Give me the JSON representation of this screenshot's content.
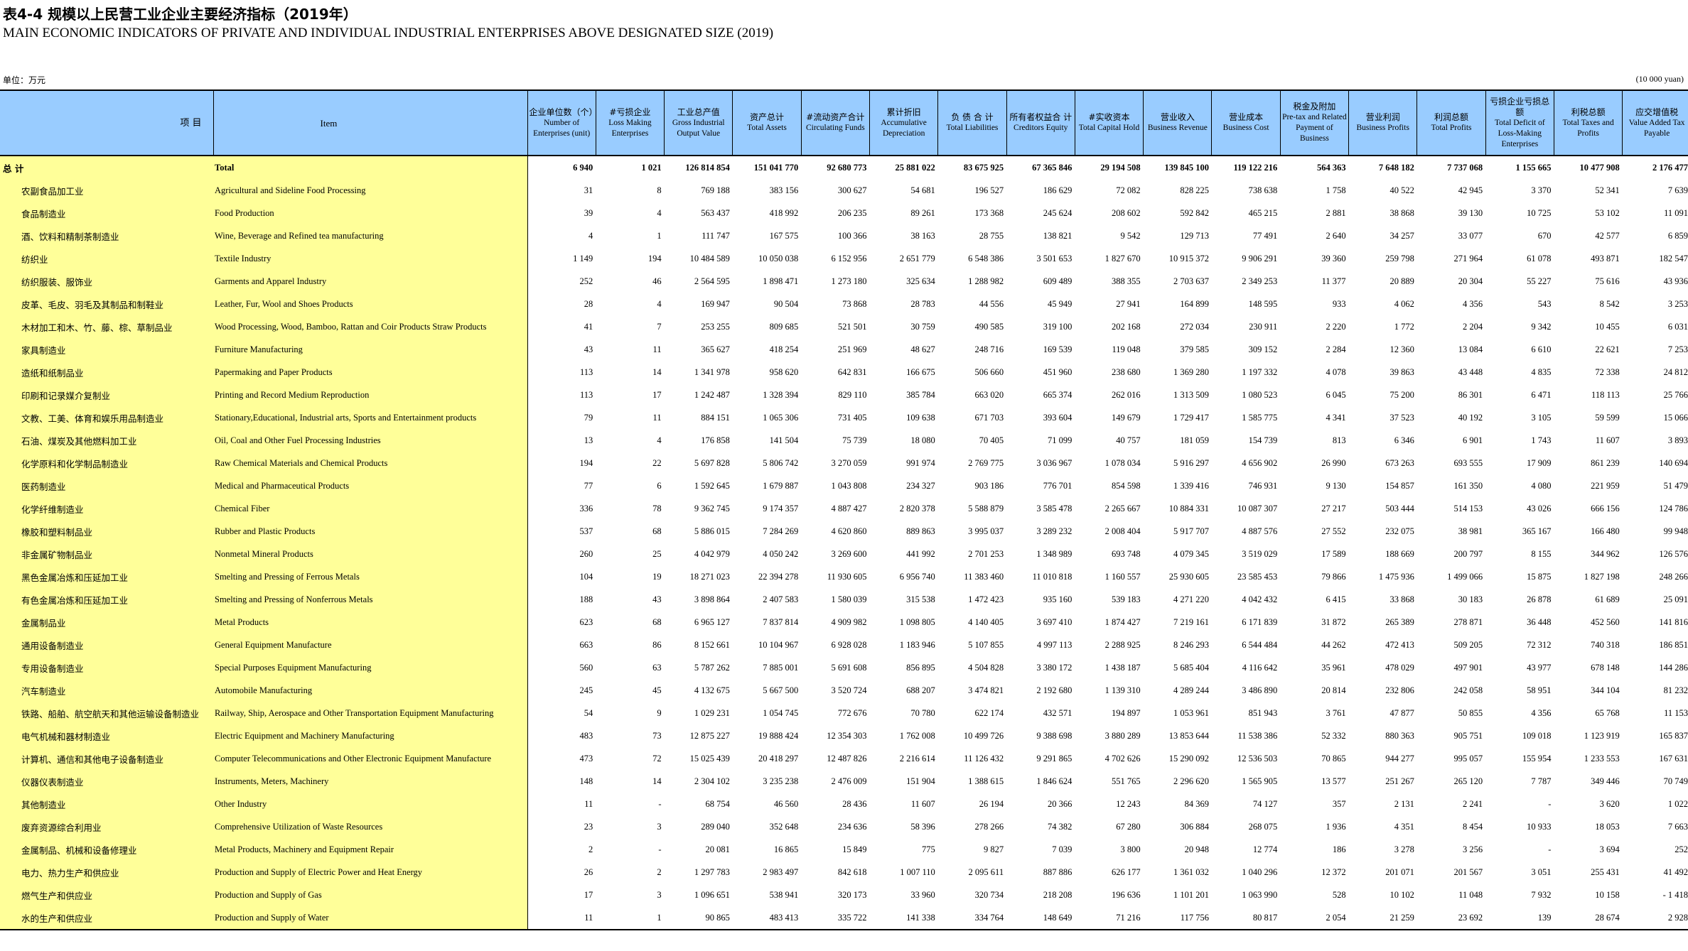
{
  "title_zh": "表4-4  规模以上民营工业企业主要经济指标（2019年）",
  "title_en": "MAIN ECONOMIC INDICATORS OF PRIVATE AND INDIVIDUAL INDUSTRIAL ENTERPRISES ABOVE DESIGNATED SIZE (2019)",
  "unit_zh": "单位：万元",
  "unit_en": "(10 000 yuan)",
  "header": {
    "item_zh": "项    目",
    "item_en": "Item",
    "columns": [
      {
        "zh": "企业单位数（个）",
        "en": "Number of Enterprises (unit)"
      },
      {
        "zh": "#亏损企业",
        "en": "Loss Making Enterprises"
      },
      {
        "zh": "工业总产值",
        "en": "Gross Industrial Output Value"
      },
      {
        "zh": "资产总计",
        "en": "Total Assets"
      },
      {
        "zh": "#流动资产合计",
        "en": "Circulating Funds"
      },
      {
        "zh": "累计折旧",
        "en": "Accumulative Depreciation"
      },
      {
        "zh": "负 债 合 计",
        "en": "Total Liabilities"
      },
      {
        "zh": "所有者权益合 计",
        "en": "Creditors Equity"
      },
      {
        "zh": "#实收资本",
        "en": "Total Capital Hold"
      },
      {
        "zh": "营业收入",
        "en": "Business Revenue"
      },
      {
        "zh": "营业成本",
        "en": "Business Cost"
      },
      {
        "zh": "税金及附加",
        "en": "Pre-tax and Related Payment of Business"
      },
      {
        "zh": "营业利润",
        "en": "Business Profits"
      },
      {
        "zh": "利润总额",
        "en": "Total Profits"
      },
      {
        "zh": "亏损企业亏损总额",
        "en": "Total Deficit of Loss-Making Enterprises"
      },
      {
        "zh": "利税总额",
        "en": "Total Taxes and Profits"
      },
      {
        "zh": "应交增值税",
        "en": "Value Added Tax Payable"
      }
    ]
  },
  "rows": [
    {
      "zh": "总  计",
      "en": "Total",
      "v": [
        "6 940",
        "1 021",
        "126 814 854",
        "151 041 770",
        "92 680 773",
        "25 881 022",
        "83 675 925",
        "67 365 846",
        "29 194 508",
        "139 845 100",
        "119 122 216",
        "564 363",
        "7 648 182",
        "7 737 068",
        "1 155 665",
        "10 477 908",
        "2 176 477"
      ]
    },
    {
      "zh": "农副食品加工业",
      "en": "Agricultural and Sideline Food Processing",
      "v": [
        "31",
        "8",
        "769 188",
        "383 156",
        "300 627",
        "54 681",
        "196 527",
        "186 629",
        "72 082",
        "828 225",
        "738 638",
        "1 758",
        "40 522",
        "42 945",
        "3 370",
        "52 341",
        "7 639"
      ]
    },
    {
      "zh": "食品制造业",
      "en": "Food Production",
      "v": [
        "39",
        "4",
        "563 437",
        "418 992",
        "206 235",
        "89 261",
        "173 368",
        "245 624",
        "208 602",
        "592 842",
        "465 215",
        "2 881",
        "38 868",
        "39 130",
        "10 725",
        "53 102",
        "11 091"
      ]
    },
    {
      "zh": "酒、饮料和精制茶制造业",
      "en": "Wine, Beverage and Refined tea manufacturing",
      "v": [
        "4",
        "1",
        "111 747",
        "167 575",
        "100 366",
        "38 163",
        "28 755",
        "138 821",
        "9 542",
        "129 713",
        "77 491",
        "2 640",
        "34 257",
        "33 077",
        "670",
        "42 577",
        "6 859"
      ]
    },
    {
      "zh": "纺织业",
      "en": "Textile Industry",
      "v": [
        "1 149",
        "194",
        "10 484 589",
        "10 050 038",
        "6 152 956",
        "2 651 779",
        "6 548 386",
        "3 501 653",
        "1 827 670",
        "10 915 372",
        "9 906 291",
        "39 360",
        "259 798",
        "271 964",
        "61 078",
        "493 871",
        "182 547"
      ]
    },
    {
      "zh": "纺织服装、服饰业",
      "en": "Garments and Apparel Industry",
      "v": [
        "252",
        "46",
        "2 564 595",
        "1 898 471",
        "1 273 180",
        "325 634",
        "1 288 982",
        "609 489",
        "388 355",
        "2 703 637",
        "2 349 253",
        "11 377",
        "20 889",
        "20 304",
        "55 227",
        "75 616",
        "43 936"
      ]
    },
    {
      "zh": "皮革、毛皮、羽毛及其制品和制鞋业",
      "en": "Leather, Fur, Wool and Shoes Products",
      "v": [
        "28",
        "4",
        "169 947",
        "90 504",
        "73 868",
        "28 783",
        "44 556",
        "45 949",
        "27 941",
        "164 899",
        "148 595",
        "933",
        "4 062",
        "4 356",
        "543",
        "8 542",
        "3 253"
      ]
    },
    {
      "zh": "木材加工和木、竹、藤、棕、草制品业",
      "en": "Wood Processing, Wood, Bamboo, Rattan and Coir Products Straw Products",
      "v": [
        "41",
        "7",
        "253 255",
        "809 685",
        "521 501",
        "30 759",
        "490 585",
        "319 100",
        "202 168",
        "272 034",
        "230 911",
        "2 220",
        "1 772",
        "2 204",
        "9 342",
        "10 455",
        "6 031"
      ]
    },
    {
      "zh": "家具制造业",
      "en": "Furniture Manufacturing",
      "v": [
        "43",
        "11",
        "365 627",
        "418 254",
        "251 969",
        "48 627",
        "248 716",
        "169 539",
        "119 048",
        "379 585",
        "309 152",
        "2 284",
        "12 360",
        "13 084",
        "6 610",
        "22 621",
        "7 253"
      ]
    },
    {
      "zh": "造纸和纸制品业",
      "en": "Papermaking and Paper Products",
      "v": [
        "113",
        "14",
        "1 341 978",
        "958 620",
        "642 831",
        "166 675",
        "506 660",
        "451 960",
        "238 680",
        "1 369 280",
        "1 197 332",
        "4 078",
        "39 863",
        "43 448",
        "4 835",
        "72 338",
        "24 812"
      ]
    },
    {
      "zh": "印刷和记录媒介复制业",
      "en": "Printing and Record Medium Reproduction",
      "v": [
        "113",
        "17",
        "1 242 487",
        "1 328 394",
        "829 110",
        "385 784",
        "663 020",
        "665 374",
        "262 016",
        "1 313 509",
        "1 080 523",
        "6 045",
        "75 200",
        "86 301",
        "6 471",
        "118 113",
        "25 766"
      ]
    },
    {
      "zh": "文教、工美、体育和娱乐用品制造业",
      "en": "Stationary,Educational, Industrial arts, Sports and Entertainment products",
      "v": [
        "79",
        "11",
        "884 151",
        "1 065 306",
        "731 405",
        "109 638",
        "671 703",
        "393 604",
        "149 679",
        "1 729 417",
        "1 585 775",
        "4 341",
        "37 523",
        "40 192",
        "3 105",
        "59 599",
        "15 066"
      ]
    },
    {
      "zh": "石油、煤炭及其他燃料加工业",
      "en": "Oil, Coal and Other Fuel Processing Industries",
      "v": [
        "13",
        "4",
        "176 858",
        "141 504",
        "75 739",
        "18 080",
        "70 405",
        "71 099",
        "40 757",
        "181 059",
        "154 739",
        "813",
        "6 346",
        "6 901",
        "1 743",
        "11 607",
        "3 893"
      ]
    },
    {
      "zh": "化学原料和化学制品制造业",
      "en": "Raw Chemical Materials and Chemical Products",
      "v": [
        "194",
        "22",
        "5 697 828",
        "5 806 742",
        "3 270 059",
        "991 974",
        "2 769 775",
        "3 036 967",
        "1 078 034",
        "5 916 297",
        "4 656 902",
        "26 990",
        "673 263",
        "693 555",
        "17 909",
        "861 239",
        "140 694"
      ]
    },
    {
      "zh": "医药制造业",
      "en": "Medical and Pharmaceutical Products",
      "v": [
        "77",
        "6",
        "1 592 645",
        "1 679 887",
        "1 043 808",
        "234 327",
        "903 186",
        "776 701",
        "854 598",
        "1 339 416",
        "746 931",
        "9 130",
        "154 857",
        "161 350",
        "4 080",
        "221 959",
        "51 479"
      ]
    },
    {
      "zh": "化学纤维制造业",
      "en": "Chemical Fiber",
      "v": [
        "336",
        "78",
        "9 362 745",
        "9 174 357",
        "4 887 427",
        "2 820 378",
        "5 588 879",
        "3 585 478",
        "2 265 667",
        "10 884 331",
        "10 087 307",
        "27 217",
        "503 444",
        "514 153",
        "43 026",
        "666 156",
        "124 786"
      ]
    },
    {
      "zh": "橡胶和塑料制品业",
      "en": "Rubber and Plastic  Products",
      "v": [
        "537",
        "68",
        "5 886 015",
        "7 284 269",
        "4 620 860",
        "889 863",
        "3 995 037",
        "3 289 232",
        "2 008 404",
        "5 917 707",
        "4 887 576",
        "27 552",
        "232 075",
        "38 981",
        "365 167",
        "166 480",
        "99 948"
      ]
    },
    {
      "zh": "非金属矿物制品业",
      "en": "Nonmetal Mineral Products",
      "v": [
        "260",
        "25",
        "4 042 979",
        "4 050 242",
        "3 269 600",
        "441 992",
        "2 701 253",
        "1 348 989",
        "693 748",
        "4 079 345",
        "3 519 029",
        "17 589",
        "188 669",
        "200 797",
        "8 155",
        "344 962",
        "126 576"
      ]
    },
    {
      "zh": "黑色金属冶炼和压延加工业",
      "en": "Smelting and Pressing of Ferrous Metals",
      "v": [
        "104",
        "19",
        "18 271 023",
        "22 394 278",
        "11 930 605",
        "6 956 740",
        "11 383 460",
        "11 010 818",
        "1 160 557",
        "25 930 605",
        "23 585 453",
        "79 866",
        "1 475 936",
        "1 499 066",
        "15 875",
        "1 827 198",
        "248 266"
      ]
    },
    {
      "zh": "有色金属冶炼和压延加工业",
      "en": "Smelting and Pressing of Nonferrous Metals",
      "v": [
        "188",
        "43",
        "3 898 864",
        "2 407 583",
        "1 580 039",
        "315 538",
        "1 472 423",
        "935 160",
        "539 183",
        "4 271 220",
        "4 042 432",
        "6 415",
        "33 868",
        "30 183",
        "26 878",
        "61 689",
        "25 091"
      ]
    },
    {
      "zh": "金属制品业",
      "en": "Metal Products",
      "v": [
        "623",
        "68",
        "6 965 127",
        "7 837 814",
        "4 909 982",
        "1 098 805",
        "4 140 405",
        "3 697 410",
        "1 874 427",
        "7 219 161",
        "6 171 839",
        "31 872",
        "265 389",
        "278 871",
        "36 448",
        "452 560",
        "141 816"
      ]
    },
    {
      "zh": "通用设备制造业",
      "en": "General Equipment Manufacture",
      "v": [
        "663",
        "86",
        "8 152 661",
        "10 104 967",
        "6 928 028",
        "1 183 946",
        "5 107 855",
        "4 997 113",
        "2 288 925",
        "8 246 293",
        "6 544 484",
        "44 262",
        "472 413",
        "509 205",
        "72 312",
        "740 318",
        "186 851"
      ]
    },
    {
      "zh": "专用设备制造业",
      "en": "Special Purposes Equipment Manufacturing",
      "v": [
        "560",
        "63",
        "5 787 262",
        "7 885 001",
        "5 691 608",
        "856 895",
        "4 504 828",
        "3 380 172",
        "1 438 187",
        "5 685 404",
        "4 116 642",
        "35 961",
        "478 029",
        "497 901",
        "43 977",
        "678 148",
        "144 286"
      ]
    },
    {
      "zh": "汽车制造业",
      "en": "Automobile Manufacturing",
      "v": [
        "245",
        "45",
        "4 132 675",
        "5 667 500",
        "3 520 724",
        "688 207",
        "3 474 821",
        "2 192 680",
        "1 139 310",
        "4 289 244",
        "3 486 890",
        "20 814",
        "232 806",
        "242 058",
        "58 951",
        "344 104",
        "81 232"
      ]
    },
    {
      "zh": "铁路、船舶、航空航天和其他运输设备制造业",
      "en": "Railway, Ship, Aerospace and Other Transportation Equipment Manufacturing",
      "v": [
        "54",
        "9",
        "1 029 231",
        "1 054 745",
        "772 676",
        "70 780",
        "622 174",
        "432 571",
        "194 897",
        "1 053 961",
        "851 943",
        "3 761",
        "47 877",
        "50 855",
        "4 356",
        "65 768",
        "11 153"
      ]
    },
    {
      "zh": "电气机械和器材制造业",
      "en": "Electric Equipment and Machinery Manufacturing",
      "v": [
        "483",
        "73",
        "12 875 227",
        "19 888 424",
        "12 354 303",
        "1 762 008",
        "10 499 726",
        "9 388 698",
        "3 880 289",
        "13 853 644",
        "11 538 386",
        "52 332",
        "880 363",
        "905 751",
        "109 018",
        "1 123 919",
        "165 837"
      ]
    },
    {
      "zh": "计算机、通信和其他电子设备制造业",
      "en": "Computer Telecommunications and Other Electronic Equipment Manufacture",
      "v": [
        "473",
        "72",
        "15 025 439",
        "20 418 297",
        "12 487 826",
        "2 216 614",
        "11 126 432",
        "9 291 865",
        "4 702 626",
        "15 290 092",
        "12 536 503",
        "70 865",
        "944 277",
        "995 057",
        "155 954",
        "1 233 553",
        "167 631"
      ]
    },
    {
      "zh": "仪器仪表制造业",
      "en": "Instruments, Meters, Machinery",
      "v": [
        "148",
        "14",
        "2 304 102",
        "3 235 238",
        "2 476 009",
        "151 904",
        "1 388 615",
        "1 846 624",
        "551 765",
        "2 296 620",
        "1 565 905",
        "13 577",
        "251 267",
        "265 120",
        "7 787",
        "349 446",
        "70 749"
      ]
    },
    {
      "zh": "其他制造业",
      "en": "Other Industry",
      "v": [
        "11",
        "-",
        "68 754",
        "46 560",
        "28 436",
        "11 607",
        "26 194",
        "20 366",
        "12 243",
        "84 369",
        "74 127",
        "357",
        "2 131",
        "2 241",
        "-",
        "3 620",
        "1 022"
      ]
    },
    {
      "zh": "废弃资源综合利用业",
      "en": "Comprehensive Utilization of  Waste Resources",
      "v": [
        "23",
        "3",
        "289 040",
        "352 648",
        "234 636",
        "58 396",
        "278 266",
        "74 382",
        "67 280",
        "306 884",
        "268 075",
        "1 936",
        "4 351",
        "8 454",
        "10 933",
        "18 053",
        "7 663"
      ]
    },
    {
      "zh": "金属制品、机械和设备修理业",
      "en": "Metal Products, Machinery and Equipment Repair",
      "v": [
        "2",
        "-",
        "20 081",
        "16 865",
        "15 849",
        "775",
        "9 827",
        "7 039",
        "3 800",
        "20 948",
        "12 774",
        "186",
        "3 278",
        "3 256",
        "-",
        "3 694",
        "252"
      ]
    },
    {
      "zh": "电力、热力生产和供应业",
      "en": "Production and Supply of Electric Power and Heat Energy",
      "v": [
        "26",
        "2",
        "1 297 783",
        "2 983 497",
        "842 618",
        "1 007 110",
        "2 095 611",
        "887 886",
        "626 177",
        "1 361 032",
        "1 040 296",
        "12 372",
        "201 071",
        "201 567",
        "3 051",
        "255 431",
        "41 492"
      ]
    },
    {
      "zh": "燃气生产和供应业",
      "en": "Production and Supply of Gas",
      "v": [
        "17",
        "3",
        "1 096 651",
        "538 941",
        "320 173",
        "33 960",
        "320 734",
        "218 208",
        "196 636",
        "1 101 201",
        "1 063 990",
        "528",
        "10 102",
        "11 048",
        "7 932",
        "10 158",
        "- 1 418"
      ]
    },
    {
      "zh": "水的生产和供应业",
      "en": "Production and Supply of Water",
      "v": [
        "11",
        "1",
        "90 865",
        "483 413",
        "335 722",
        "141 338",
        "334 764",
        "148 649",
        "71 216",
        "117 756",
        "80 817",
        "2 054",
        "21 259",
        "23 692",
        "139",
        "28 674",
        "2 928"
      ]
    }
  ]
}
